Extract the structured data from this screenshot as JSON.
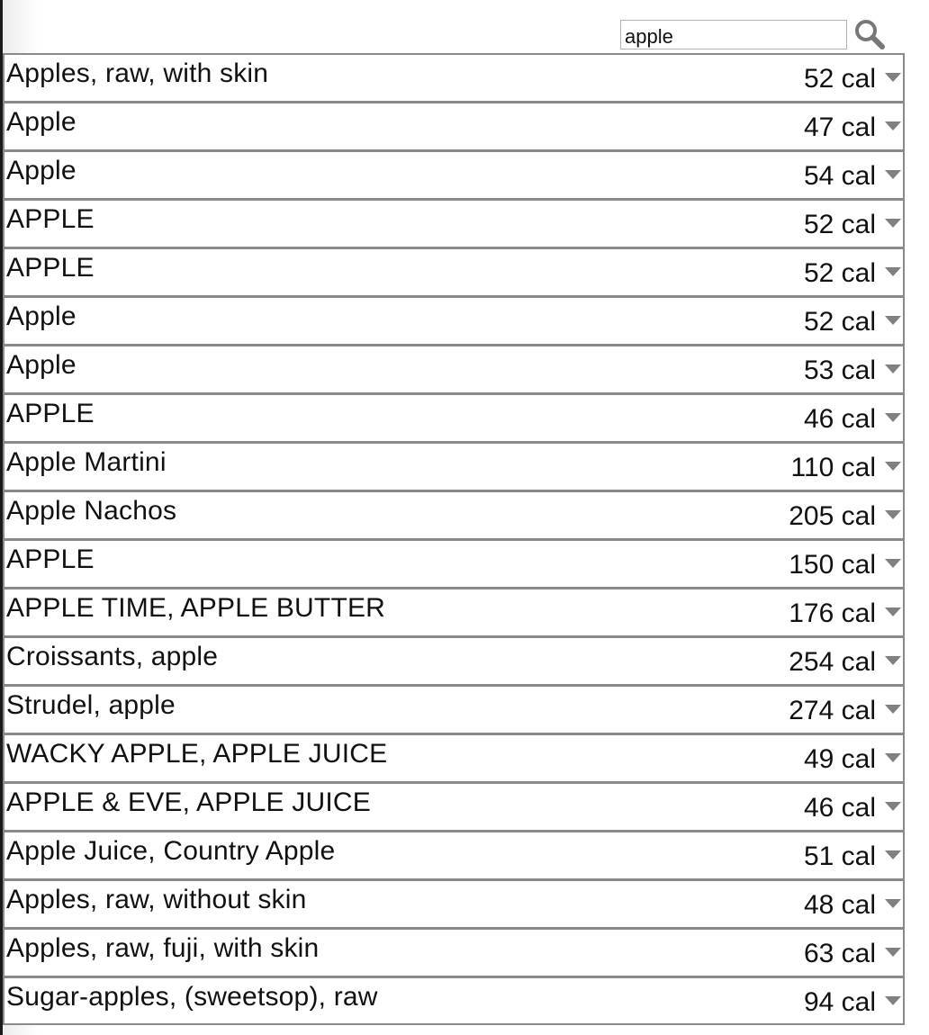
{
  "search": {
    "value": "apple",
    "icon": "search-icon"
  },
  "results": [
    {
      "name": "Apples, raw, with skin",
      "calories": "52 cal"
    },
    {
      "name": "Apple",
      "calories": "47 cal"
    },
    {
      "name": "Apple",
      "calories": "54 cal"
    },
    {
      "name": "APPLE",
      "calories": "52 cal"
    },
    {
      "name": "APPLE",
      "calories": "52 cal"
    },
    {
      "name": "Apple",
      "calories": "52 cal"
    },
    {
      "name": "Apple",
      "calories": "53 cal"
    },
    {
      "name": "APPLE",
      "calories": "46 cal"
    },
    {
      "name": "Apple Martini",
      "calories": "110 cal"
    },
    {
      "name": "Apple Nachos",
      "calories": "205 cal"
    },
    {
      "name": "APPLE",
      "calories": "150 cal"
    },
    {
      "name": "APPLE TIME, APPLE BUTTER",
      "calories": "176 cal"
    },
    {
      "name": "Croissants, apple",
      "calories": "254 cal"
    },
    {
      "name": "Strudel, apple",
      "calories": "274 cal"
    },
    {
      "name": "WACKY APPLE, APPLE JUICE",
      "calories": "49 cal"
    },
    {
      "name": "APPLE & EVE, APPLE JUICE",
      "calories": "46 cal"
    },
    {
      "name": "Apple Juice, Country Apple",
      "calories": "51 cal"
    },
    {
      "name": "Apples, raw, without skin",
      "calories": "48 cal"
    },
    {
      "name": "Apples, raw, fuji, with skin",
      "calories": "63 cal"
    },
    {
      "name": "Sugar-apples, (sweetsop), raw",
      "calories": "94 cal"
    }
  ],
  "colors": {
    "border": "#8a8a8a",
    "text": "#111111",
    "arrow": "#808080",
    "search_icon": "#777777"
  }
}
